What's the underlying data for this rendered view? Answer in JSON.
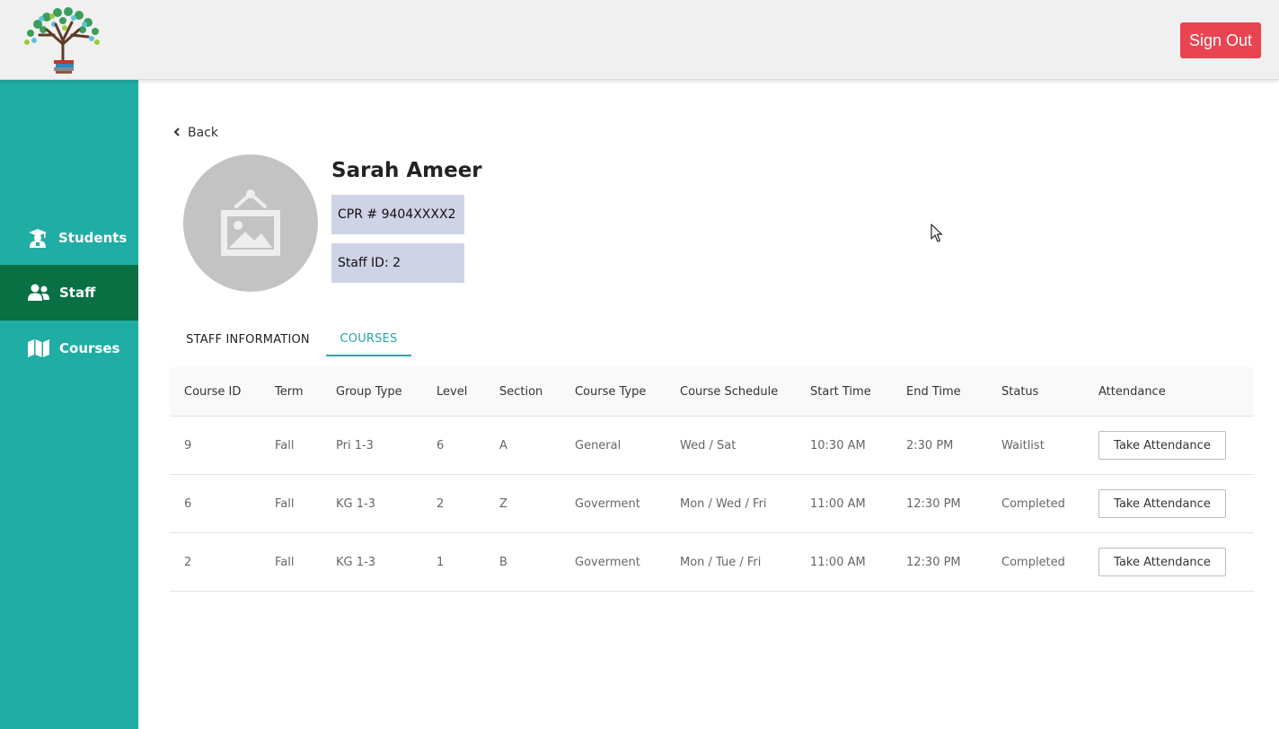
{
  "header": {
    "signout_label": "Sign Out"
  },
  "sidebar": {
    "items": [
      {
        "label": "Students",
        "icon": "graduate-icon",
        "active": false
      },
      {
        "label": "Staff",
        "icon": "users-icon",
        "active": true
      },
      {
        "label": "Courses",
        "icon": "map-icon",
        "active": false
      }
    ]
  },
  "back": {
    "label": "Back"
  },
  "profile": {
    "name": "Sarah Ameer",
    "cpr": "CPR # 9404XXXX2",
    "staff_id": "Staff ID: 2"
  },
  "tabs": [
    {
      "label": "STAFF INFORMATION",
      "active": false
    },
    {
      "label": "COURSES",
      "active": true
    }
  ],
  "table": {
    "columns": [
      "Course ID",
      "Term",
      "Group Type",
      "Level",
      "Section",
      "Course Type",
      "Course Schedule",
      "Start Time",
      "End Time",
      "Status",
      "Attendance"
    ],
    "rows": [
      {
        "course_id": "9",
        "term": "Fall",
        "group_type": "Pri 1-3",
        "level": "6",
        "section": "A",
        "course_type": "General",
        "schedule": "Wed / Sat",
        "start": "10:30 AM",
        "end": "2:30 PM",
        "status": "Waitlist",
        "action": "Take Attendance"
      },
      {
        "course_id": "6",
        "term": "Fall",
        "group_type": "KG 1-3",
        "level": "2",
        "section": "Z",
        "course_type": "Goverment",
        "schedule": "Mon / Wed / Fri",
        "start": "11:00 AM",
        "end": "12:30 PM",
        "status": "Completed",
        "action": "Take Attendance"
      },
      {
        "course_id": "2",
        "term": "Fall",
        "group_type": "KG 1-3",
        "level": "1",
        "section": "B",
        "course_type": "Goverment",
        "schedule": "Mon / Tue / Fri",
        "start": "11:00 AM",
        "end": "12:30 PM",
        "status": "Completed",
        "action": "Take Attendance"
      }
    ]
  },
  "colors": {
    "sidebar": "#20ada3",
    "sidebar_active": "#087043",
    "signout": "#e94452",
    "tab_active": "#2aa3ab",
    "info_box": "#cfd3e6"
  }
}
